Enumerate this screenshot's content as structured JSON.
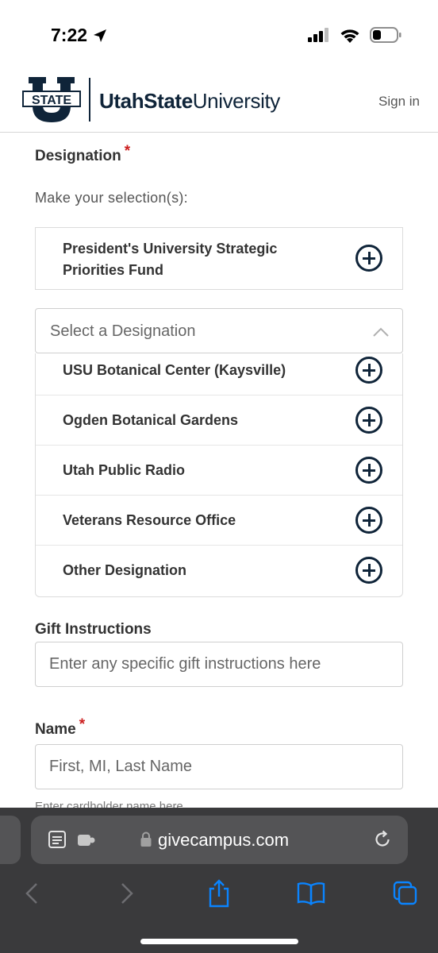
{
  "status": {
    "time": "7:22"
  },
  "header": {
    "logo_mark_top": "STATE",
    "logo_part1": "UtahState",
    "logo_part2": "University",
    "sign_in": "Sign in"
  },
  "designation": {
    "label": "Designation",
    "required_mark": "*",
    "help": "Make your selection(s):",
    "selected": "President's University Strategic Priorities Fund",
    "select_placeholder": "Select a Designation",
    "options": [
      {
        "label": "USU Botanical Center (Kaysville)"
      },
      {
        "label": "Ogden Botanical Gardens"
      },
      {
        "label": "Utah Public Radio"
      },
      {
        "label": "Veterans Resource Office"
      },
      {
        "label": "Other Designation"
      }
    ]
  },
  "gift_instructions": {
    "label": "Gift Instructions",
    "placeholder": "Enter any specific gift instructions here"
  },
  "name": {
    "label": "Name",
    "required_mark": "*",
    "placeholder": "First, MI, Last Name",
    "hint": "Enter cardholder name here"
  },
  "browser": {
    "url": "givecampus.com"
  },
  "colors": {
    "brand_navy": "#0f2439",
    "required_red": "#cc1f1f",
    "safari_toolbar": "#3a3a3c",
    "safari_blue": "#0a84ff"
  }
}
